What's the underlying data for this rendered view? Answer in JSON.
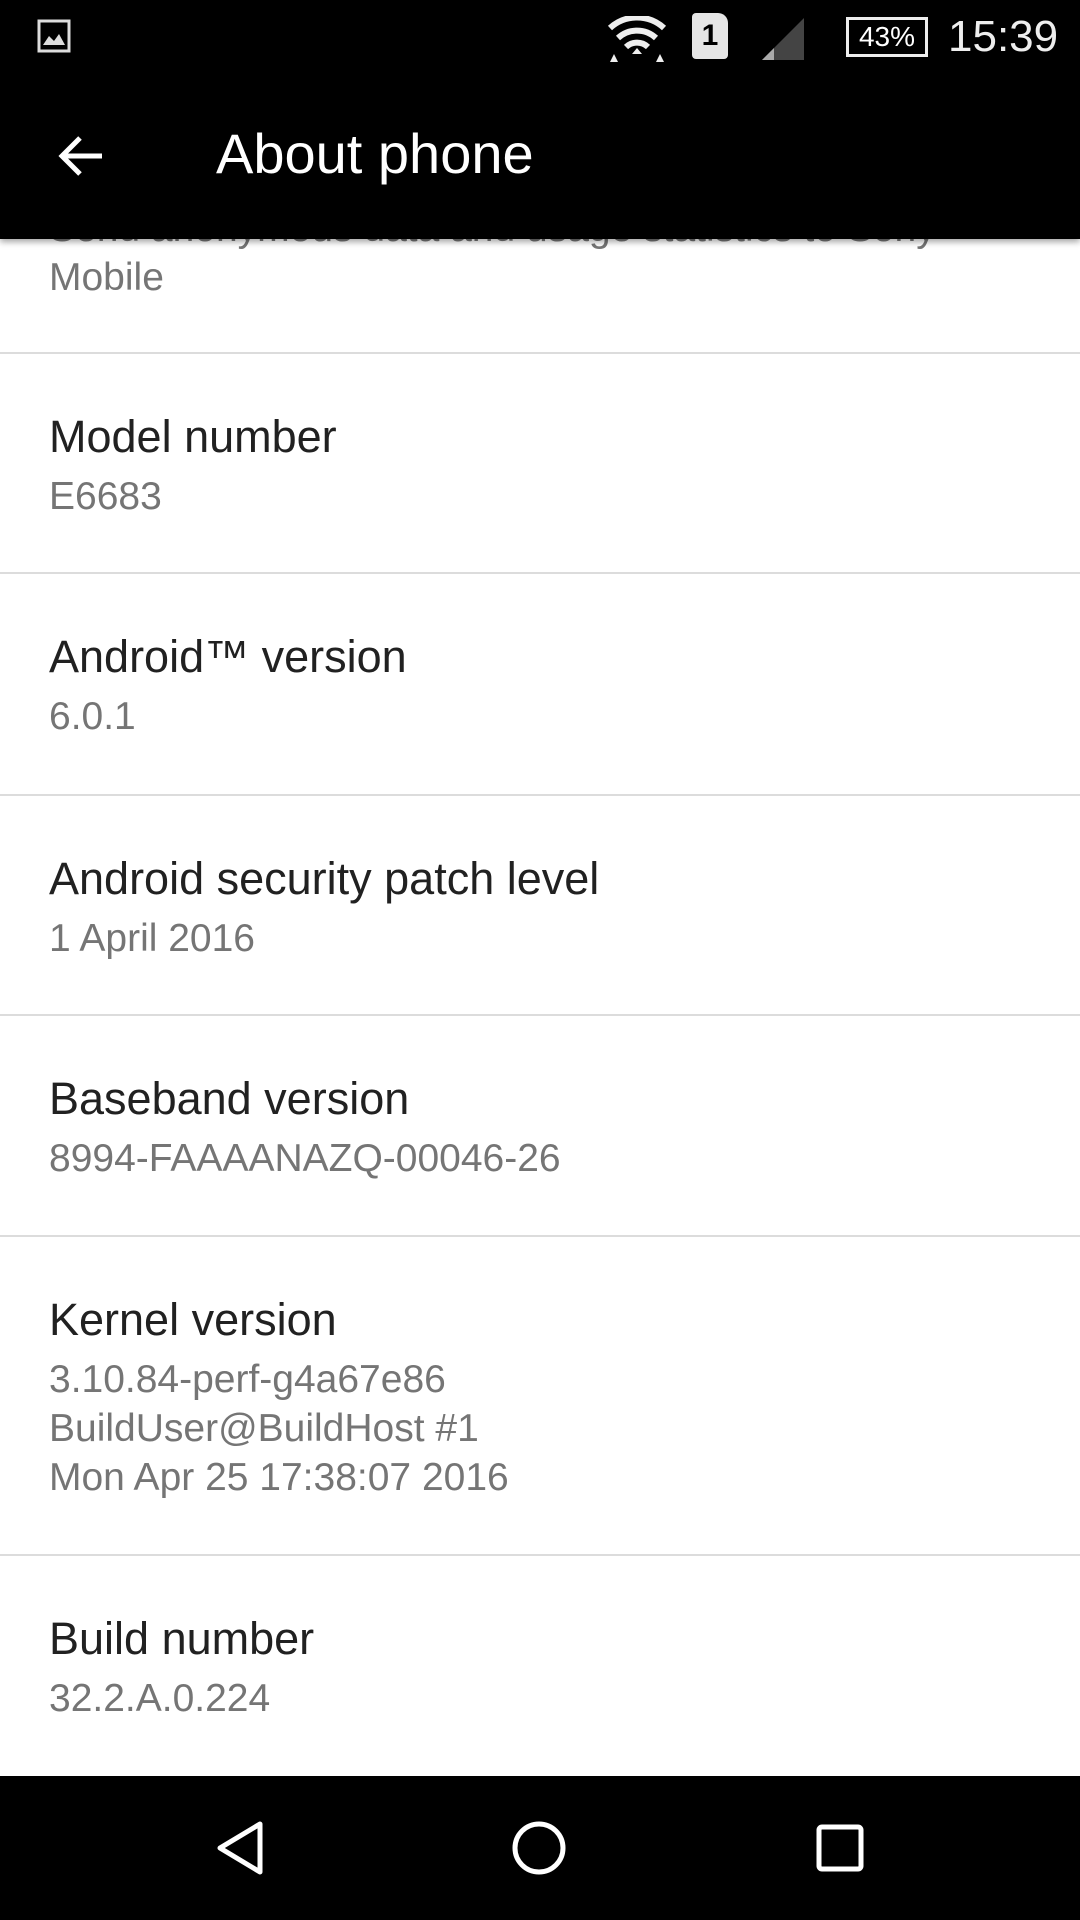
{
  "status_bar": {
    "notification_icon": "image-icon",
    "icons": [
      "wifi-icon",
      "sim-1-icon",
      "signal-icon"
    ],
    "sim_label": "1",
    "battery": "43%",
    "time": "15:39"
  },
  "toolbar": {
    "back_icon": "arrow-left-icon",
    "title": "About phone"
  },
  "partial_item": {
    "summary_lines": [
      "Send anonymous data and usage statistics to Sony",
      "Mobile"
    ]
  },
  "items": [
    {
      "title": "Model number",
      "summary": [
        "E6683"
      ]
    },
    {
      "title": "Android™ version",
      "summary": [
        "6.0.1"
      ]
    },
    {
      "title": "Android security patch level",
      "summary": [
        "1 April 2016"
      ]
    },
    {
      "title": "Baseband version",
      "summary": [
        "8994-FAAAANAZQ-00046-26"
      ]
    },
    {
      "title": "Kernel version",
      "summary": [
        "3.10.84-perf-g4a67e86",
        "BuildUser@BuildHost #1",
        "Mon Apr 25 17:38:07 2016"
      ]
    },
    {
      "title": "Build number",
      "summary": [
        "32.2.A.0.224"
      ]
    }
  ],
  "nav_bar": [
    "back-triangle-icon",
    "home-circle-icon",
    "recents-square-icon"
  ]
}
